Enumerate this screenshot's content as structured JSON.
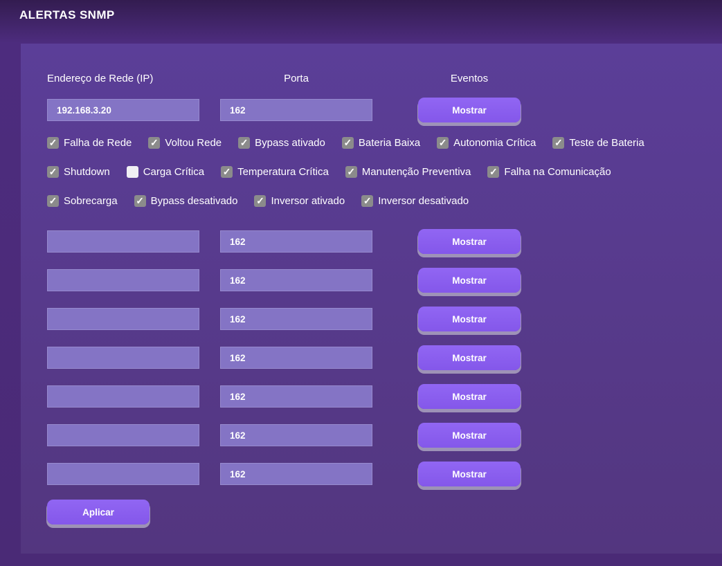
{
  "page": {
    "title": "ALERTAS SNMP"
  },
  "colors": {
    "background": "#4a2a77",
    "panel": "#57398f",
    "field": "#8474c5",
    "accent_button": "#8b5ff0",
    "button_shadow": "#aaa2bf",
    "checkbox_checked": "#8b8b8b",
    "checkbox_unchecked": "#f0eff4",
    "text": "#ffffff"
  },
  "icons": {
    "checkmark": "✓"
  },
  "form": {
    "headers": {
      "ip": "Endereço de Rede (IP)",
      "port": "Porta",
      "events": "Eventos"
    },
    "show_button_label": "Mostrar",
    "apply_button_label": "Aplicar",
    "rows": [
      {
        "ip": "192.168.3.20",
        "port": "162"
      },
      {
        "ip": "",
        "port": "162"
      },
      {
        "ip": "",
        "port": "162"
      },
      {
        "ip": "",
        "port": "162"
      },
      {
        "ip": "",
        "port": "162"
      },
      {
        "ip": "",
        "port": "162"
      },
      {
        "ip": "",
        "port": "162"
      },
      {
        "ip": "",
        "port": "162"
      }
    ],
    "event_rows": [
      [
        {
          "label": "Falha de Rede",
          "checked": true
        },
        {
          "label": "Voltou Rede",
          "checked": true
        },
        {
          "label": "Bypass ativado",
          "checked": true
        },
        {
          "label": "Bateria Baixa",
          "checked": true
        },
        {
          "label": "Autonomia Crítica",
          "checked": true
        },
        {
          "label": "Teste de Bateria",
          "checked": true
        }
      ],
      [
        {
          "label": "Shutdown",
          "checked": true
        },
        {
          "label": "Carga Crítica",
          "checked": false
        },
        {
          "label": "Temperatura Crítica",
          "checked": true
        },
        {
          "label": "Manutenção Preventiva",
          "checked": true
        },
        {
          "label": "Falha na Comunicação",
          "checked": true
        }
      ],
      [
        {
          "label": "Sobrecarga",
          "checked": true
        },
        {
          "label": "Bypass desativado",
          "checked": true
        },
        {
          "label": "Inversor ativado",
          "checked": true
        },
        {
          "label": "Inversor desativado",
          "checked": true
        }
      ]
    ]
  }
}
